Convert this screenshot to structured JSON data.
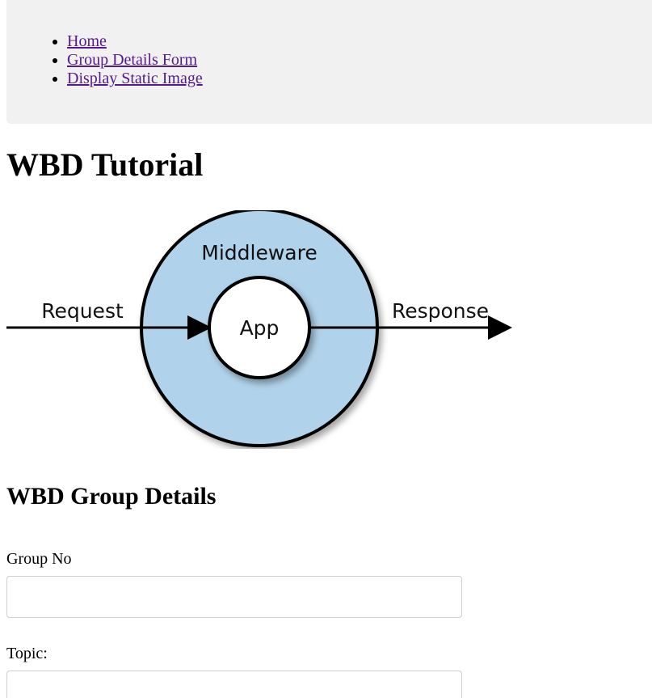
{
  "nav": {
    "items": [
      {
        "label": "Home"
      },
      {
        "label": "Group Details Form"
      },
      {
        "label": "Display Static Image"
      }
    ]
  },
  "page_title": "WBD Tutorial",
  "diagram": {
    "outer_label": "Middleware",
    "inner_label": "App",
    "left_label": "Request",
    "right_label": "Response",
    "outer_fill": "#b0d2ea",
    "inner_fill": "#ffffff",
    "stroke": "#000000"
  },
  "form": {
    "title": "WBD Group Details",
    "fields": [
      {
        "label": "Group No",
        "value": "",
        "placeholder": ""
      },
      {
        "label": "Topic:",
        "value": "",
        "placeholder": ""
      }
    ]
  }
}
